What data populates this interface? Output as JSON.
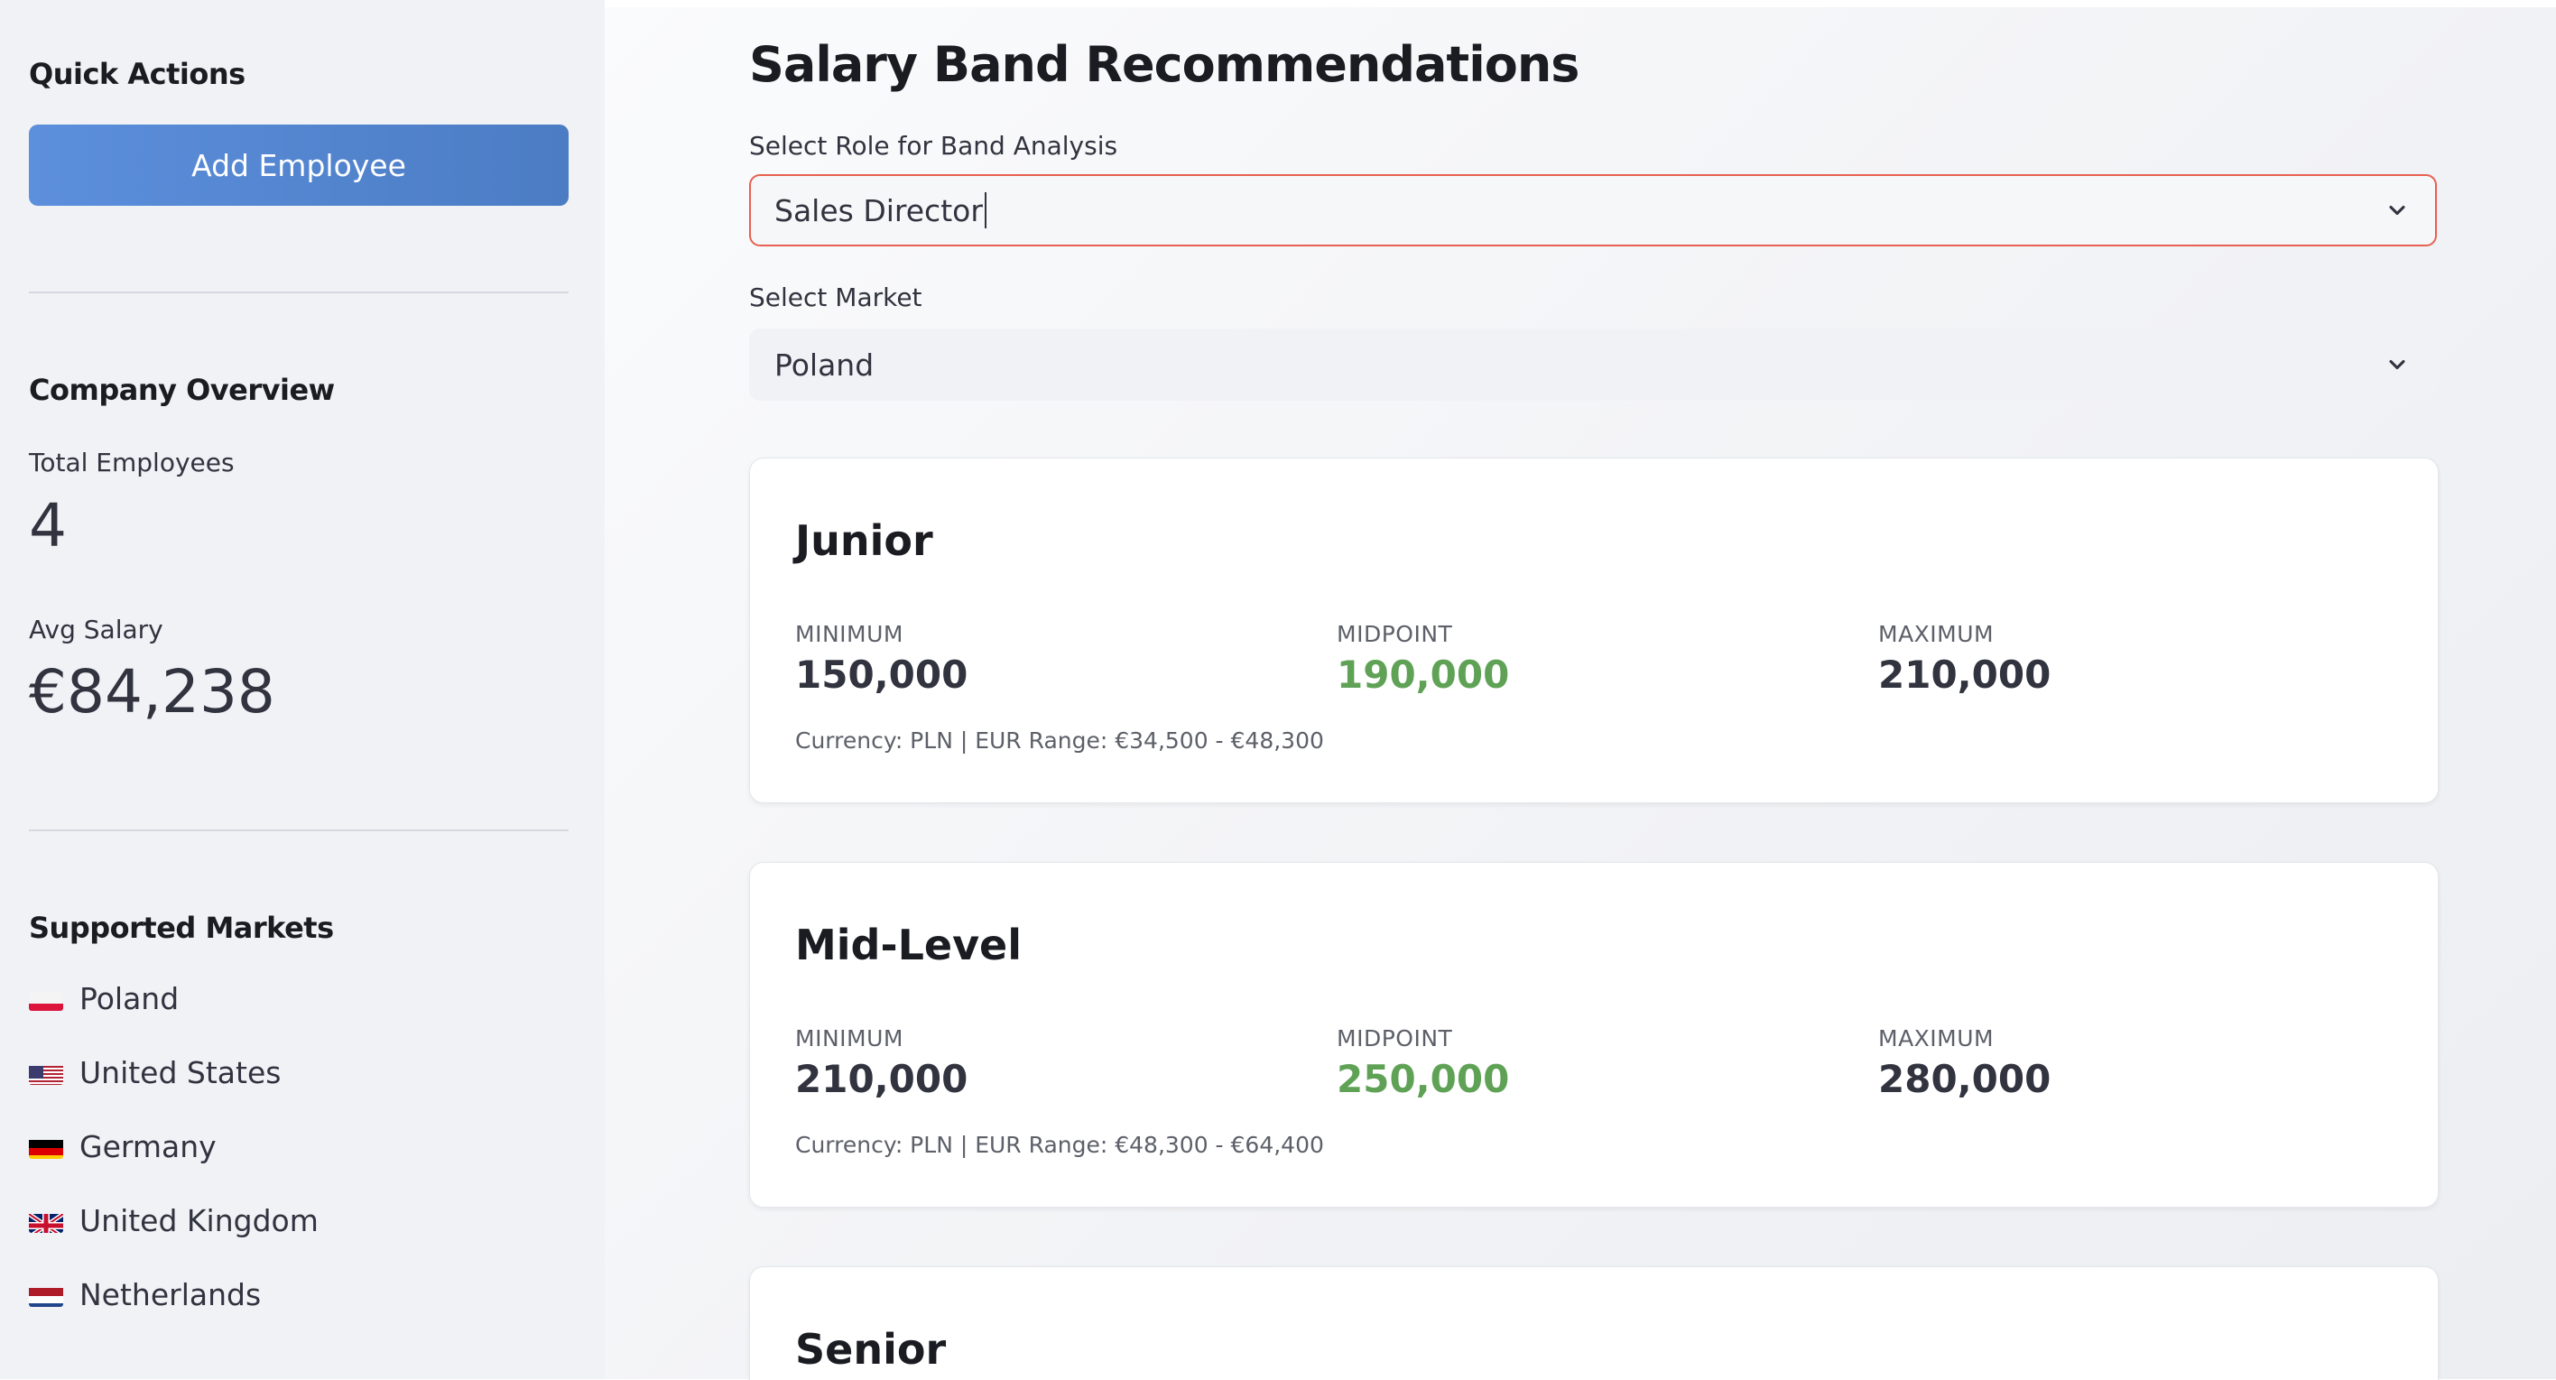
{
  "sidebar": {
    "quick_actions_title": "Quick Actions",
    "add_employee_label": "Add Employee",
    "company_overview_title": "Company Overview",
    "total_employees_label": "Total Employees",
    "total_employees_value": "4",
    "avg_salary_label": "Avg Salary",
    "avg_salary_value": "€84,238",
    "supported_markets_title": "Supported Markets",
    "markets": [
      {
        "label": "Poland",
        "flag": "flag-poland-icon"
      },
      {
        "label": "United States",
        "flag": "flag-united-states-icon"
      },
      {
        "label": "Germany",
        "flag": "flag-germany-icon"
      },
      {
        "label": "United Kingdom",
        "flag": "flag-united-kingdom-icon"
      },
      {
        "label": "Netherlands",
        "flag": "flag-netherlands-icon"
      }
    ]
  },
  "main": {
    "title": "Salary Band Recommendations",
    "role_select": {
      "label": "Select Role for Band Analysis",
      "value": "Sales Director"
    },
    "market_select": {
      "label": "Select Market",
      "value": "Poland"
    },
    "bands": [
      {
        "title": "Junior",
        "min_label": "MINIMUM",
        "min_value": "150,000",
        "mid_label": "MIDPOINT",
        "mid_value": "190,000",
        "max_label": "MAXIMUM",
        "max_value": "210,000",
        "note": "Currency: PLN | EUR Range: €34,500 - €48,300"
      },
      {
        "title": "Mid-Level",
        "min_label": "MINIMUM",
        "min_value": "210,000",
        "mid_label": "MIDPOINT",
        "mid_value": "250,000",
        "max_label": "MAXIMUM",
        "max_value": "280,000",
        "note": "Currency: PLN | EUR Range: €48,300 - €64,400"
      },
      {
        "title": "Senior"
      }
    ]
  },
  "colors": {
    "accent_button": "#5c8fdc",
    "midpoint_green": "#5fa256",
    "focus_border": "#e8604f"
  }
}
